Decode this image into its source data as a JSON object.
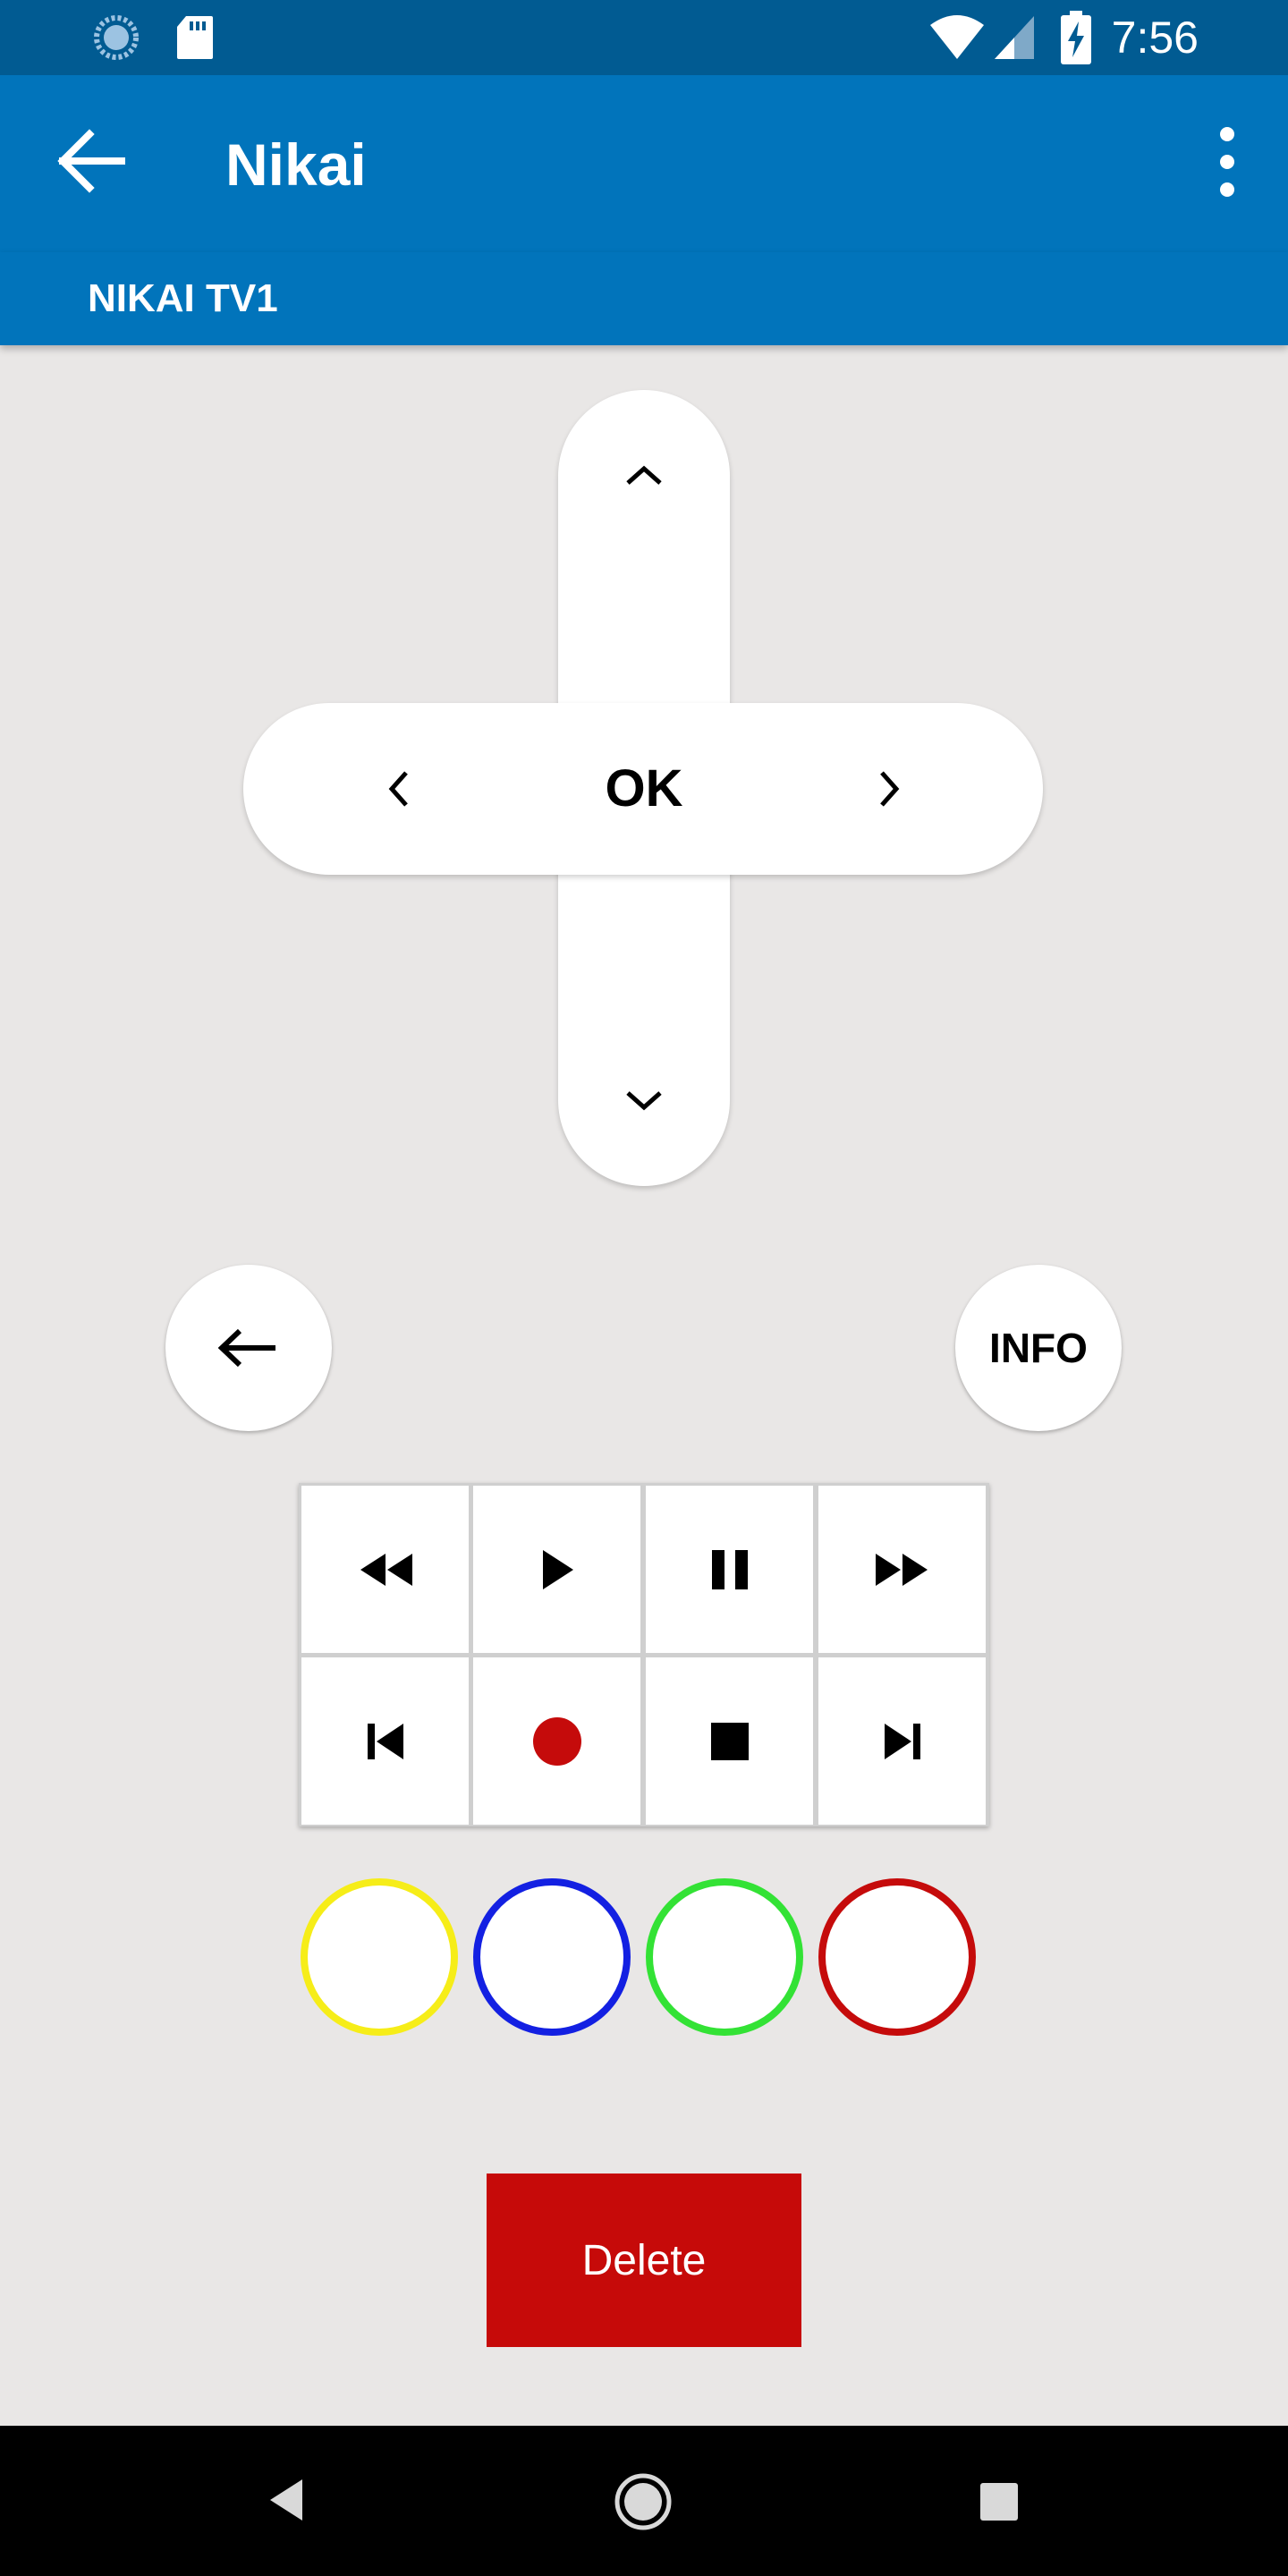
{
  "status_bar": {
    "time": "7:56"
  },
  "app_bar": {
    "title": "Nikai"
  },
  "device": {
    "label": "NIKAI TV1"
  },
  "dpad": {
    "center_label": "OK"
  },
  "buttons": {
    "info_label": "INFO",
    "delete_label": "Delete"
  },
  "color_buttons": [
    "#f6ed18",
    "#1320e2",
    "#33e235",
    "#c50b0b"
  ],
  "colors": {
    "primary": "#0174bb",
    "status_bar": "#015b92",
    "background": "#e9e7e6",
    "danger": "#c60a09",
    "record_dot": "#c50b0b"
  }
}
